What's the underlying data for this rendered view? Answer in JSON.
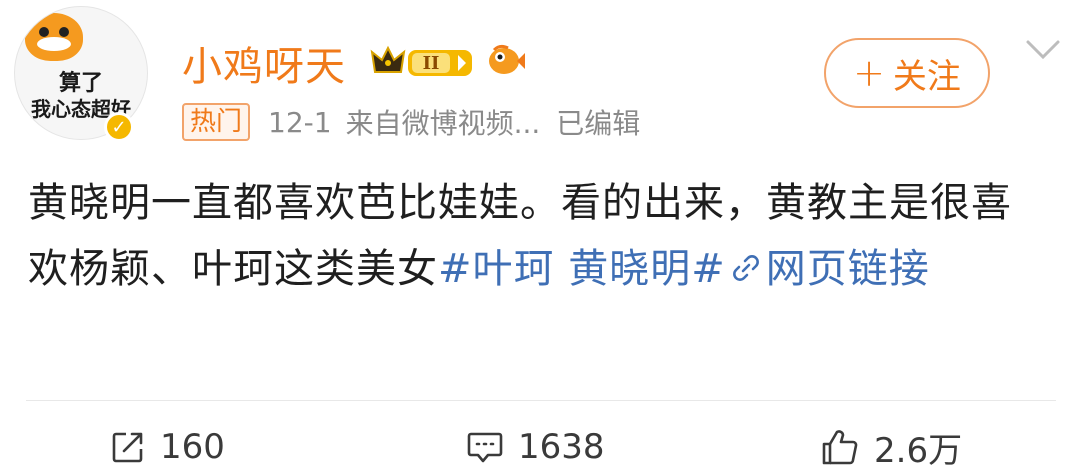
{
  "author": {
    "avatar_caption_line1": "算了",
    "avatar_caption_line2": "我心态超好",
    "name": "小鸡呀天",
    "vip_level": "II"
  },
  "header": {
    "follow_label": "关注",
    "follow_plus": "+"
  },
  "meta": {
    "hot_badge": "热门",
    "time": "12-1",
    "source_prefix": "来自",
    "source_name": "微博视频...",
    "edited_label": "已编辑"
  },
  "post": {
    "text": "黄晓明一直都喜欢芭比娃娃。看的出来，黄教主是很喜欢杨颖、叶珂这类美女",
    "hashtag": "#叶珂 黄晓明#",
    "link_text": "网页链接"
  },
  "actions": {
    "repost_count": "160",
    "comment_count": "1638",
    "like_count": "2.6万"
  },
  "colors": {
    "accent_orange": "#f07a1a",
    "link_blue": "#3f6fb5",
    "meta_gray": "#8a8a8a"
  },
  "icons": {
    "repost": "share-square-icon",
    "comment": "comment-bubble-icon",
    "like": "thumbs-up-icon",
    "link": "link-chain-icon",
    "chevron": "chevron-down-icon"
  }
}
